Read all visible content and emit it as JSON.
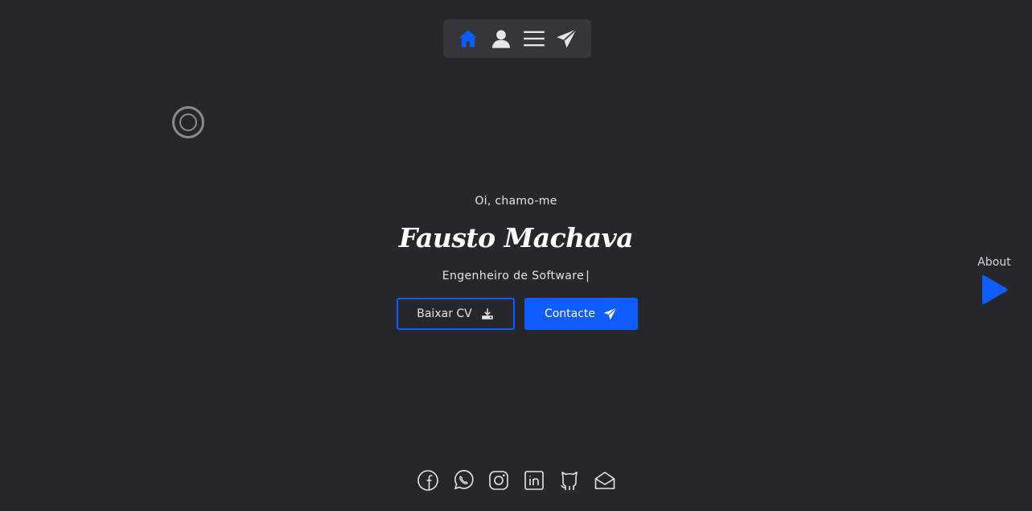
{
  "colors": {
    "background": "#27272b",
    "accent": "#0f5cff",
    "nav_bg": "#35353a",
    "text": "#e6e6ea"
  },
  "nav": {
    "items": [
      {
        "icon": "home-icon",
        "active": true
      },
      {
        "icon": "user-icon",
        "active": false
      },
      {
        "icon": "menu-icon",
        "active": false
      },
      {
        "icon": "send-icon",
        "active": false
      }
    ]
  },
  "hero": {
    "greeting": "Oi, chamo-me",
    "name": "Fausto Machava",
    "role": "Engenheiro de Software",
    "cursor": "|",
    "cv_button": "Baixar CV",
    "contact_button": "Contacte"
  },
  "side_link": {
    "label": "About",
    "icon": "play-arrow-icon"
  },
  "socials": [
    "facebook-icon",
    "whatsapp-icon",
    "instagram-icon",
    "linkedin-icon",
    "github-icon",
    "mail-icon"
  ]
}
